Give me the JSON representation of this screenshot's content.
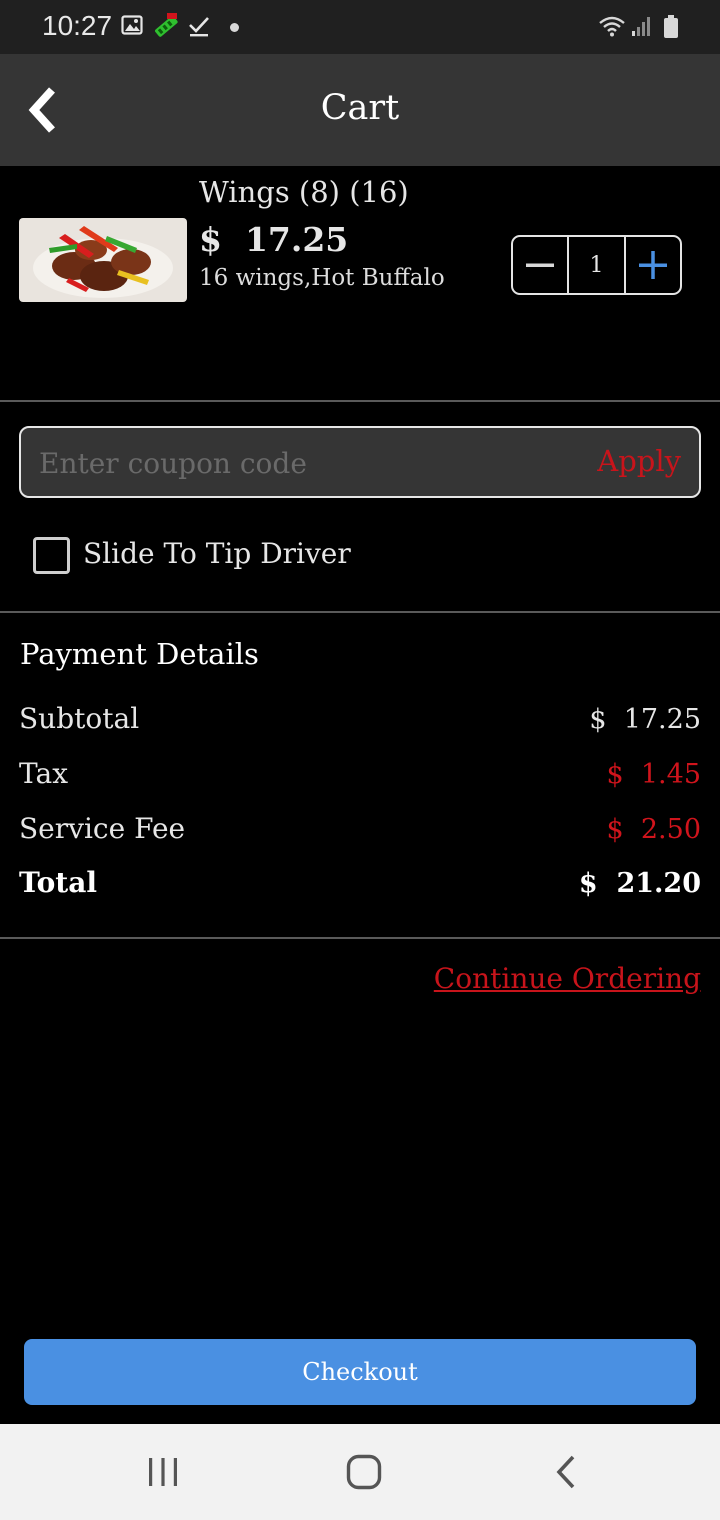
{
  "status_bar": {
    "time": "10:27",
    "icons": [
      "image-icon",
      "app-notification-icon",
      "check-icon",
      "dot-icon",
      "wifi-icon",
      "signal-icon",
      "battery-icon"
    ]
  },
  "header": {
    "title": "Cart",
    "back_icon": "chevron-left-icon"
  },
  "cart": {
    "items": [
      {
        "name": "Wings (8) (16)",
        "price": "$  17.25",
        "options": "16 wings,Hot Buffalo",
        "quantity": "1",
        "image": "chicken-wings-photo"
      }
    ]
  },
  "coupon": {
    "placeholder": "Enter coupon code",
    "apply_label": "Apply"
  },
  "tip": {
    "label": "Slide To Tip Driver",
    "checked": false
  },
  "payment": {
    "heading": "Payment Details",
    "rows": [
      {
        "label": "Subtotal",
        "value": "$  17.25"
      },
      {
        "label": "Tax",
        "value": "$  1.45"
      },
      {
        "label": "Service Fee",
        "value": "$  2.50"
      },
      {
        "label": "Total",
        "value": "$  21.20"
      }
    ]
  },
  "continue_label": "Continue Ordering",
  "checkout_label": "Checkout",
  "nav_bar": {
    "icons": [
      "recent-apps-icon",
      "home-icon",
      "back-icon"
    ]
  },
  "colors": {
    "accent_blue": "#4a90e2",
    "accent_red": "#c8141b",
    "header_bg": "#353535",
    "background": "#000000"
  }
}
